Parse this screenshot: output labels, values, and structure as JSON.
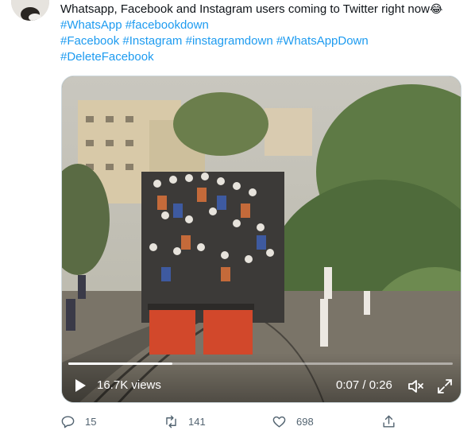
{
  "tweet": {
    "lines": [
      [
        {
          "text": "Whatsapp, Facebook and Instagram users coming to Twitter right now"
        },
        {
          "text": "😂",
          "emoji": true
        }
      ],
      [
        {
          "text": "#WhatsApp",
          "tag": true
        },
        {
          "text": " "
        },
        {
          "text": "#facebookdown",
          "tag": true
        }
      ],
      [
        {
          "text": "#Facebook",
          "tag": true
        },
        {
          "text": " "
        },
        {
          "text": "#Instagram",
          "tag": true
        },
        {
          "text": " "
        },
        {
          "text": "#instagramdown",
          "tag": true
        },
        {
          "text": " "
        },
        {
          "text": "#WhatsAppDown",
          "tag": true
        }
      ],
      [
        {
          "text": "#DeleteFacebook",
          "tag": true
        }
      ]
    ]
  },
  "video": {
    "views": "16.7K views",
    "time": "0:07 / 0:26",
    "progress": 0.27,
    "play_icon": "play-icon",
    "volume_icon": "volume-icon",
    "fullscreen_icon": "fullscreen-icon"
  },
  "actions": {
    "reply_count": "15",
    "retweet_count": "141",
    "like_count": "698",
    "share_icon": "share-icon"
  },
  "colors": {
    "hashtag": "#1d9bf0",
    "text": "#0f1419",
    "secondary": "#536471"
  }
}
